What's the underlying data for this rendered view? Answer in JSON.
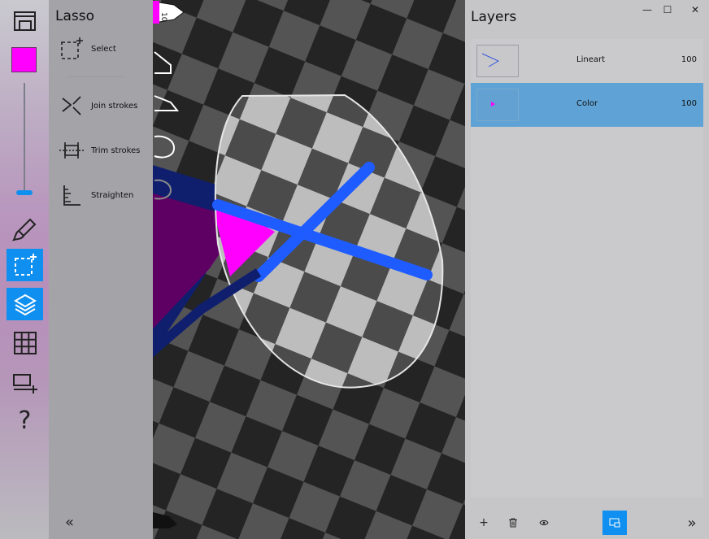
{
  "lasso": {
    "title": "Lasso",
    "tools": [
      {
        "label": "Select",
        "icon": "lasso-select-icon"
      },
      {
        "label": "Join strokes",
        "icon": "join-strokes-icon"
      },
      {
        "label": "Trim strokes",
        "icon": "trim-strokes-icon"
      },
      {
        "label": "Straighten",
        "icon": "straighten-icon"
      }
    ],
    "collapse_label": "«"
  },
  "toolbar": {
    "current_color": "#ff00ff",
    "accent_color": "#0f8ff0",
    "brush_size_level": 0.02,
    "active_tools": [
      "lasso",
      "layers"
    ]
  },
  "canvas": {
    "brush_size": "10"
  },
  "layers": {
    "title": "Layers",
    "items": [
      {
        "name": "Lineart",
        "opacity": "100",
        "selected": false
      },
      {
        "name": "Color",
        "opacity": "100",
        "selected": true
      }
    ],
    "add_label": "+",
    "collapse_label": "»"
  },
  "window": {
    "minimize": "—",
    "maximize": "☐",
    "close": "✕"
  }
}
